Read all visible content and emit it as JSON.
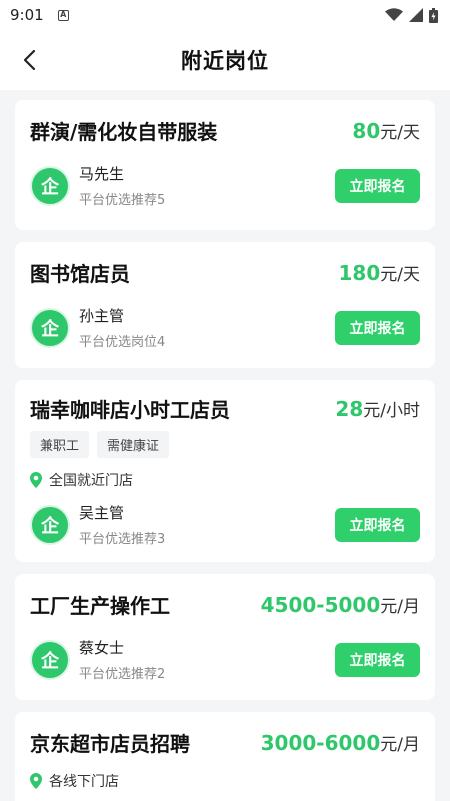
{
  "status_bar": {
    "time": "9:01",
    "notification_glyph": "A"
  },
  "header": {
    "title": "附近岗位"
  },
  "colors": {
    "accent": "#2fc76b",
    "button": "#2fd06b"
  },
  "jobs": [
    {
      "title": "群演/需化妆自带服装",
      "salary_amount": "80",
      "salary_unit": "元/天",
      "tags": [],
      "location": "",
      "poster_avatar": "企",
      "poster_name": "马先生",
      "poster_sub": "平台优选推荐5",
      "apply_label": "立即报名"
    },
    {
      "title": "图书馆店员",
      "salary_amount": "180",
      "salary_unit": "元/天",
      "tags": [],
      "location": "",
      "poster_avatar": "企",
      "poster_name": "孙主管",
      "poster_sub": "平台优选岗位4",
      "apply_label": "立即报名"
    },
    {
      "title": "瑞幸咖啡店小时工店员",
      "salary_amount": "28",
      "salary_unit": "元/小时",
      "tags": [
        "兼职工",
        "需健康证"
      ],
      "location": "全国就近门店",
      "poster_avatar": "企",
      "poster_name": "吴主管",
      "poster_sub": "平台优选推荐3",
      "apply_label": "立即报名"
    },
    {
      "title": "工厂生产操作工",
      "salary_amount": "4500-5000",
      "salary_unit": "元/月",
      "tags": [],
      "location": "",
      "poster_avatar": "企",
      "poster_name": "蔡女士",
      "poster_sub": "平台优选推荐2",
      "apply_label": "立即报名"
    },
    {
      "title": "京东超市店员招聘",
      "salary_amount": "3000-6000",
      "salary_unit": "元/月",
      "tags": [],
      "location": "各线下门店",
      "poster_avatar": "",
      "poster_name": "",
      "poster_sub": "",
      "apply_label": ""
    }
  ]
}
